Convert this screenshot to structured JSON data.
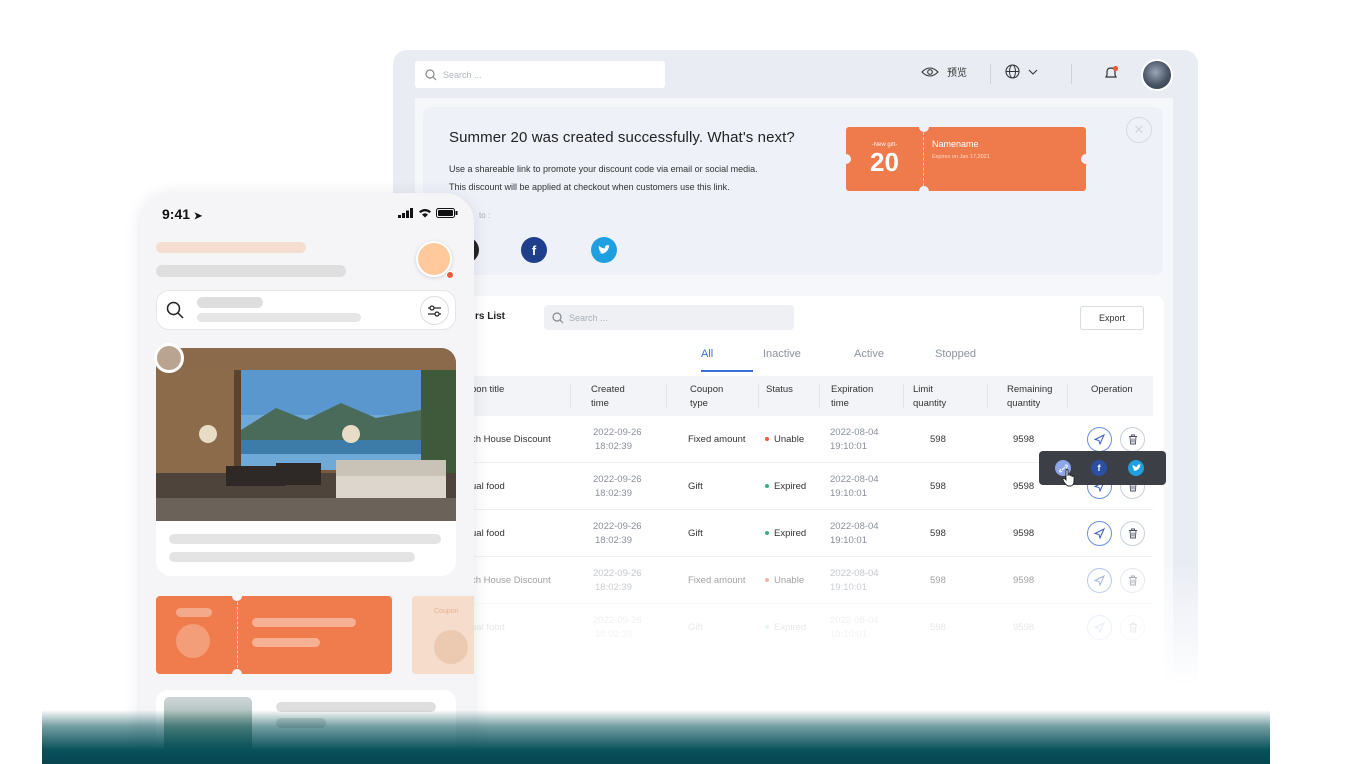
{
  "topbar": {
    "search_placeholder": "Search ...",
    "preview_label": "预览",
    "colors": {
      "bell_dot": "#f05a3c"
    }
  },
  "banner": {
    "title": "Summer 20 was created successfully. What's next?",
    "desc_line1": "Use a shareable link to promote your discount code via email or social media.",
    "desc_line2": "This discount will be applied at checkout when customers use this link.",
    "share_label": "to :",
    "gift": {
      "tag": "-New gift-",
      "number": "20",
      "name": "Namename",
      "expires": "Expires on Jan 17,2021"
    }
  },
  "coupons": {
    "heading": "rs List",
    "search_placeholder": "Search ...",
    "export_label": "Export",
    "tabs": [
      {
        "label": "All",
        "active": true
      },
      {
        "label": "Inactive",
        "active": false
      },
      {
        "label": "Active",
        "active": false
      },
      {
        "label": "Stopped",
        "active": false
      }
    ],
    "columns": {
      "title": "pon title",
      "created_1": "Created",
      "created_2": "time",
      "type_1": "Coupon",
      "type_2": "type",
      "status": "Status",
      "exp_1": "Expiration",
      "exp_2": "time",
      "limit_1": "Limit",
      "limit_2": "quantity",
      "remain_1": "Remaining",
      "remain_2": "quantity",
      "operation": "Operation"
    },
    "rows": [
      {
        "title": "ch House Discount",
        "created_date": "2022-09-26",
        "created_time": "18:02:39",
        "type": "Fixed amount",
        "status": "Unable",
        "status_color": "#f05a3c",
        "exp_date": "2022-08-04",
        "exp_time": "19:10:01",
        "limit": "598",
        "remaining": "9598"
      },
      {
        "title": "ual food",
        "created_date": "2022-09-26",
        "created_time": "18:02:39",
        "type": "Gift",
        "status": "Expired",
        "status_color": "#34b38a",
        "exp_date": "2022-08-04",
        "exp_time": "19:10:01",
        "limit": "598",
        "remaining": "9598"
      },
      {
        "title": "ual food",
        "created_date": "2022-09-26",
        "created_time": "18:02:39",
        "type": "Gift",
        "status": "Expired",
        "status_color": "#34b38a",
        "exp_date": "2022-08-04",
        "exp_time": "19:10:01",
        "limit": "598",
        "remaining": "9598"
      },
      {
        "title": "ch House Discount",
        "created_date": "2022-09-26",
        "created_time": "18:02:39",
        "type": "Fixed amount",
        "status": "Unable",
        "status_color": "#f05a3c",
        "exp_date": "2022-08-04",
        "exp_time": "19:10:01",
        "limit": "598",
        "remaining": "9598"
      },
      {
        "title": "ual food",
        "created_date": "2022-09-26",
        "created_time": "18:02:39",
        "type": "Gift",
        "status": "Expired",
        "status_color": "#34b38a",
        "exp_date": "2022-08-04",
        "exp_time": "19:10:01",
        "limit": "598",
        "remaining": "9598"
      }
    ]
  },
  "phone": {
    "time": "9:41",
    "coupon2_label": "Coupon"
  },
  "colors": {
    "accent": "#3a6fd8",
    "coupon_orange": "#ef7a4c",
    "facebook": "#1f3f8c",
    "twitter": "#1f9fe0",
    "teal_band": "#07505a"
  }
}
